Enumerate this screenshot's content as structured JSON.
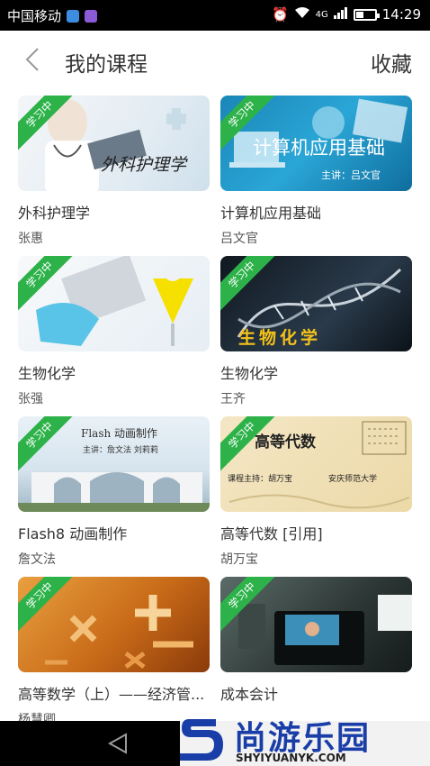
{
  "status_bar": {
    "carrier": "中国移动",
    "network": "4G",
    "time": "14:29"
  },
  "header": {
    "title": "我的课程",
    "favorite_label": "收藏"
  },
  "badge_label": "学习中",
  "courses": [
    {
      "name": "外科护理学",
      "teacher": "张惠",
      "thumb_text": "外科护理学"
    },
    {
      "name": "计算机应用基础",
      "teacher": "吕文官",
      "thumb_text": "计算机应用基础",
      "thumb_subtext": "主讲：吕文官"
    },
    {
      "name": "生物化学",
      "teacher": "张强"
    },
    {
      "name": "生物化学",
      "teacher": "王齐",
      "thumb_text": "生物化学"
    },
    {
      "name": "Flash8 动画制作",
      "teacher": "詹文法",
      "thumb_text": "Flash 动画制作",
      "thumb_subtext": "主讲：詹文法 刘莉莉"
    },
    {
      "name": "高等代数 [引用]",
      "teacher": "胡万宝",
      "thumb_text": "高等代数",
      "thumb_subtext": "课程主持：胡万宝",
      "thumb_subtext2": "安庆师范大学"
    },
    {
      "name": "高等数学（上）——经济管...",
      "teacher": "杨慧卿"
    },
    {
      "name": "成本会计",
      "teacher": ""
    }
  ],
  "watermark": {
    "brand": "尚游乐园",
    "url": "SHYIYUANYK.COM"
  }
}
